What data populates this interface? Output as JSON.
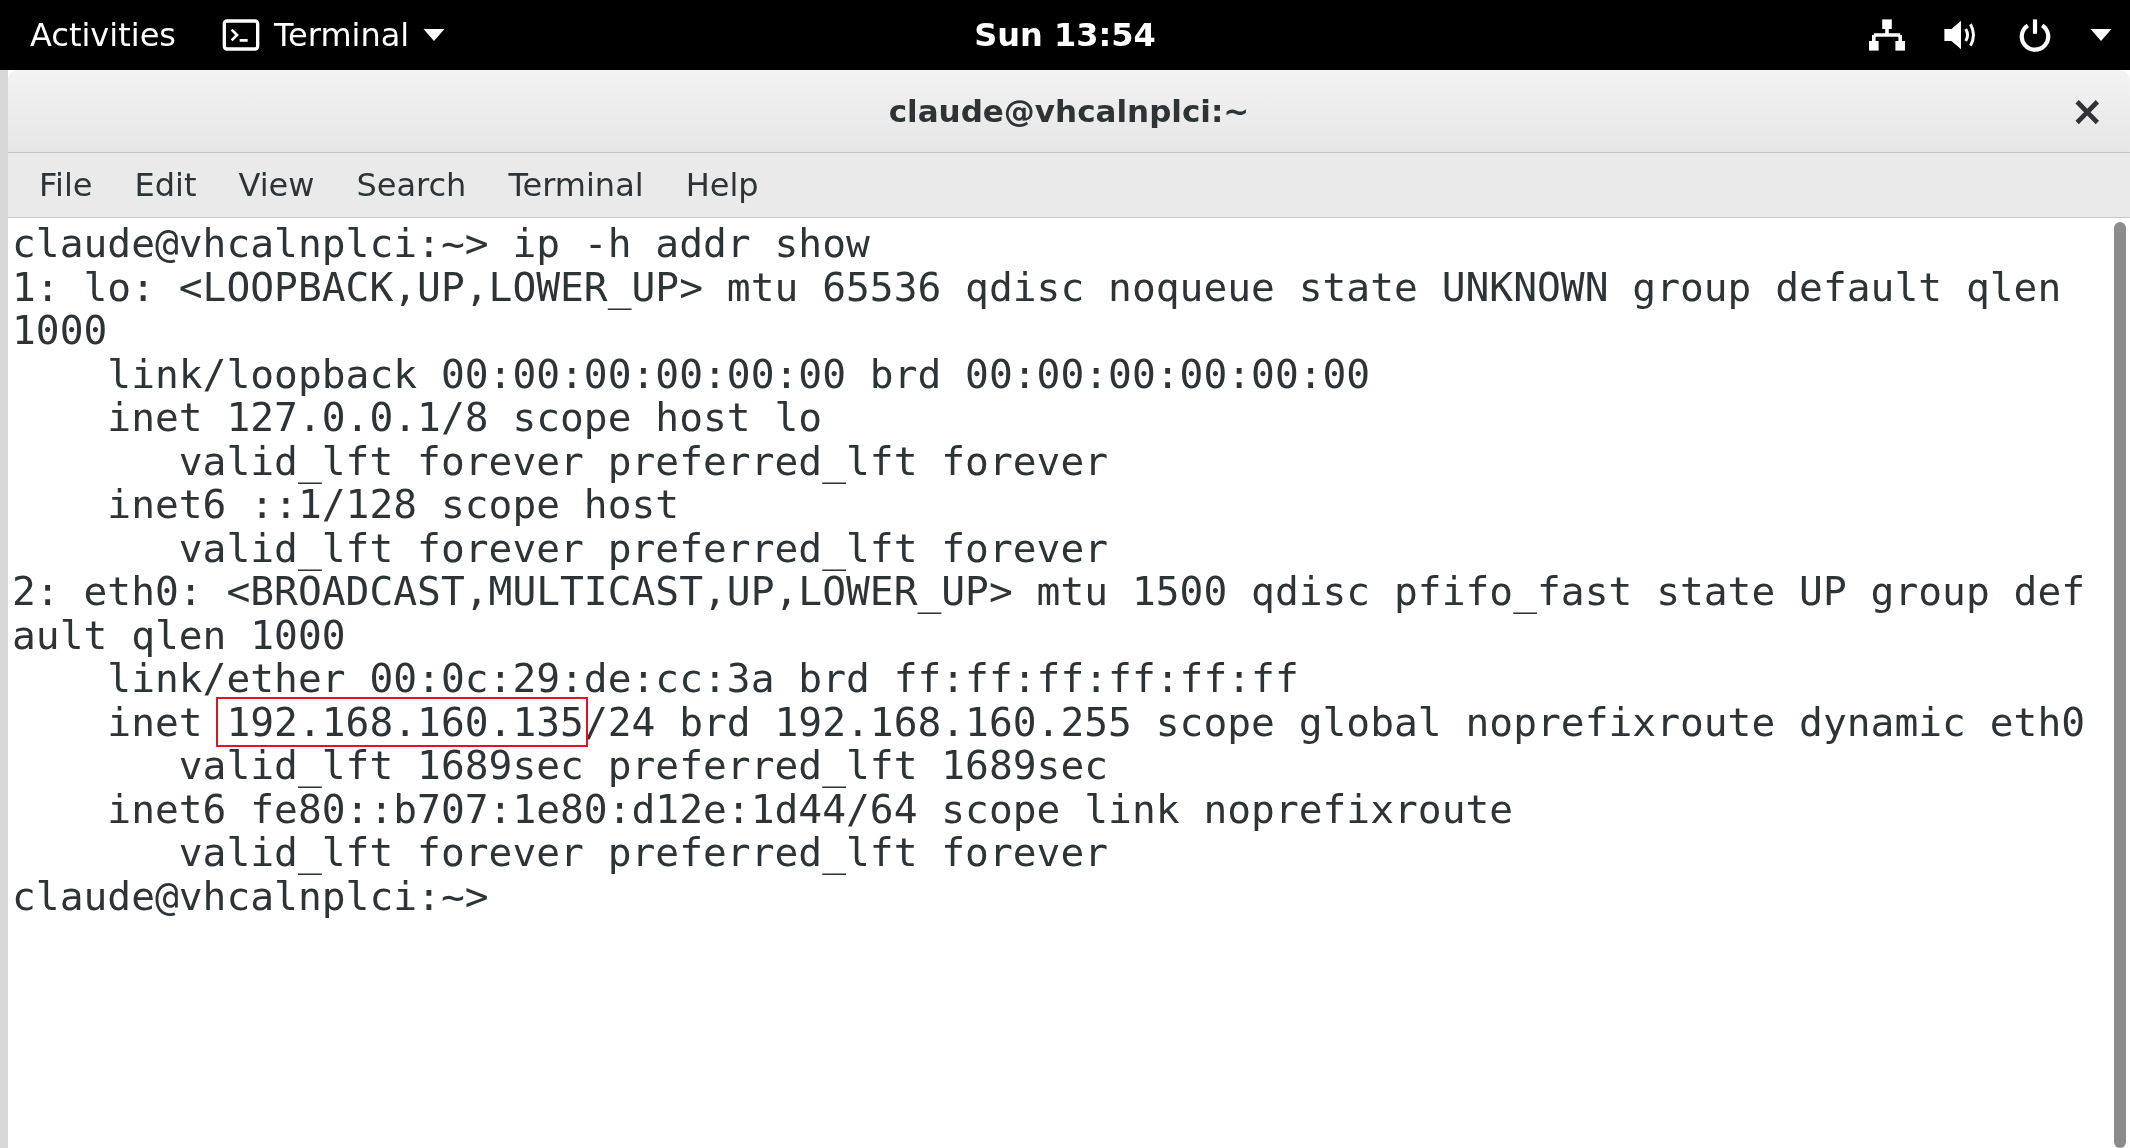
{
  "top_bar": {
    "activities": "Activities",
    "app_menu": "Terminal",
    "clock": "Sun 13:54"
  },
  "window": {
    "title": "claude@vhcalnplci:~",
    "close": "×"
  },
  "menu": [
    "File",
    "Edit",
    "View",
    "Search",
    "Terminal",
    "Help"
  ],
  "terminal": {
    "lines": [
      {
        "segments": [
          {
            "text": "claude@vhcalnplci:~> ip -h addr show",
            "boxed": false
          }
        ]
      },
      {
        "segments": [
          {
            "text": "1: lo: <LOOPBACK,UP,LOWER_UP> mtu 65536 qdisc noqueue state UNKNOWN group default qlen",
            "boxed": false
          }
        ]
      },
      {
        "segments": [
          {
            "text": "1000",
            "boxed": false
          }
        ]
      },
      {
        "segments": [
          {
            "text": "    link/loopback 00:00:00:00:00:00 brd 00:00:00:00:00:00",
            "boxed": false
          }
        ]
      },
      {
        "segments": [
          {
            "text": "    inet 127.0.0.1/8 scope host lo",
            "boxed": false
          }
        ]
      },
      {
        "segments": [
          {
            "text": "       valid_lft forever preferred_lft forever",
            "boxed": false
          }
        ]
      },
      {
        "segments": [
          {
            "text": "    inet6 ::1/128 scope host",
            "boxed": false
          }
        ]
      },
      {
        "segments": [
          {
            "text": "       valid_lft forever preferred_lft forever",
            "boxed": false
          }
        ]
      },
      {
        "segments": [
          {
            "text": "2: eth0: <BROADCAST,MULTICAST,UP,LOWER_UP> mtu 1500 qdisc pfifo_fast state UP group def",
            "boxed": false
          }
        ]
      },
      {
        "segments": [
          {
            "text": "ault qlen 1000",
            "boxed": false
          }
        ]
      },
      {
        "segments": [
          {
            "text": "    link/ether 00:0c:29:de:cc:3a brd ff:ff:ff:ff:ff:ff",
            "boxed": false
          }
        ]
      },
      {
        "segments": [
          {
            "text": "    inet ",
            "boxed": false
          },
          {
            "text": "192.168.160.135",
            "boxed": true
          },
          {
            "text": "/24 brd 192.168.160.255 scope global noprefixroute dynamic eth0",
            "boxed": false
          }
        ]
      },
      {
        "segments": [
          {
            "text": "       valid_lft 1689sec preferred_lft 1689sec",
            "boxed": false
          }
        ]
      },
      {
        "segments": [
          {
            "text": "    inet6 fe80::b707:1e80:d12e:1d44/64 scope link noprefixroute",
            "boxed": false
          }
        ]
      },
      {
        "segments": [
          {
            "text": "       valid_lft forever preferred_lft forever",
            "boxed": false
          }
        ]
      },
      {
        "segments": [
          {
            "text": "claude@vhcalnplci:~>",
            "boxed": false
          }
        ]
      }
    ]
  }
}
